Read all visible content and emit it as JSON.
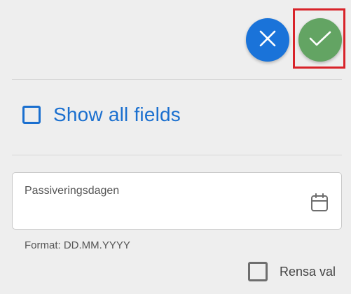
{
  "actions": {
    "cancel_icon": "close-icon",
    "confirm_icon": "check-icon",
    "cancel_color": "#1a73d9",
    "confirm_color": "#63a463",
    "highlight_color": "#d8232a"
  },
  "show_all": {
    "label": "Show all fields",
    "checked": false,
    "color": "#1a6fcf"
  },
  "date_field": {
    "label": "Passiveringsdagen",
    "value": "",
    "icon": "calendar-icon",
    "format_hint": "Format: DD.MM.YYYY"
  },
  "clear_selection": {
    "label": "Rensa val",
    "checked": false
  }
}
